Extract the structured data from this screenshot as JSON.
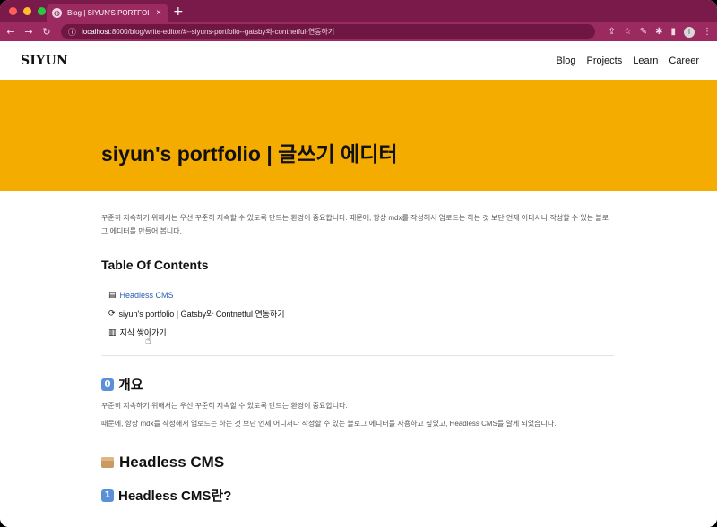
{
  "browser": {
    "tab_title": "Blog | SIYUN'S PORTFOLIO",
    "url_host": "localhost",
    "url_rest": ":8000/blog/write-editor/#--siyuns-portfolio--gatsby와-contnetful-연동하기"
  },
  "site": {
    "logo": "SIYUN",
    "nav": [
      "Blog",
      "Projects",
      "Learn",
      "Career"
    ]
  },
  "hero": {
    "title": "siyun's portfolio | 글쓰기 에디터"
  },
  "article": {
    "intro": "꾸준히 지속하기 위해서는 우선 꾸준히 지속할 수 있도록 만드는 환경이 중요합니다. 때문에, 항상 mdx를 작성해서 업로드는 하는 것 보단 언제 어디서나 작성할 수 있는 블로그 에디터를 만들어 봅니다.",
    "toc_heading": "Table Of Contents",
    "toc": [
      {
        "icon": "box-icon",
        "label": "Headless CMS"
      },
      {
        "icon": "sync-icon",
        "label": "siyun's portfolio | Gatsby와 Contnetful 연동하기"
      },
      {
        "icon": "books-icon",
        "label": "지식 쌓아가기"
      }
    ],
    "section_overview": {
      "number": "0",
      "title": "개요",
      "para1": "꾸준히 지속하기 위해서는 우선 꾸준히 지속할 수 있도록 만드는 환경이 중요합니다.",
      "para2": "때문에, 항상 mdx를 작성해서 업로드는 하는 것 보단 언제 어디서나 작성할 수 있는 블로그 에디터를 사용하고 싶었고, Headless CMS를 알게 되었습니다."
    },
    "section_cms": {
      "title": "Headless CMS"
    },
    "section_cms_what": {
      "number": "1",
      "title": "Headless CMS란?"
    }
  }
}
